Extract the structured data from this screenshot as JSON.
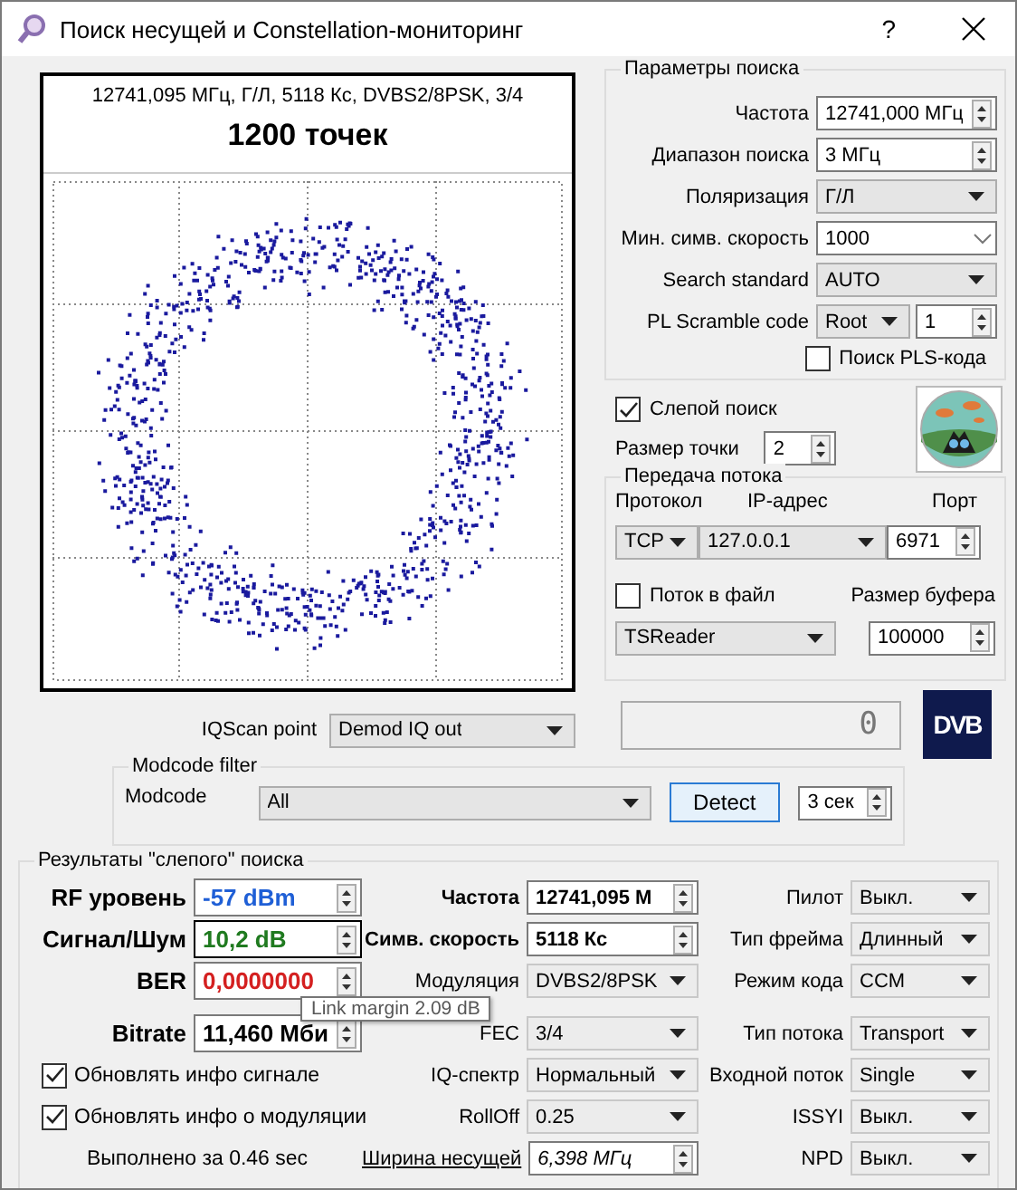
{
  "window": {
    "title": "Поиск несущей и Constellation-мониторинг",
    "help": "?"
  },
  "plot": {
    "info": "12741,095 МГц, Г/Л, 5118 Кс, DVBS2/8PSK, 3/4",
    "points": "1200 точек"
  },
  "search_params": {
    "title": "Параметры поиска",
    "fields": [
      {
        "label": "Частота",
        "value": "12741,000 МГц",
        "kind": "spin"
      },
      {
        "label": "Диапазон поиска",
        "value": "3 МГц",
        "kind": "spin"
      },
      {
        "label": "Поляризация",
        "value": "Г/Л",
        "kind": "combo"
      },
      {
        "label": "Мин. симв. скорость",
        "value": "1000",
        "kind": "edit"
      },
      {
        "label": "Search standard",
        "value": "AUTO",
        "kind": "combo"
      },
      {
        "label": "PL Scramble code",
        "value": "Root",
        "spin_value": "1",
        "kind": "combospin"
      }
    ],
    "pls_search": {
      "label": "Поиск PLS-кода",
      "checked": false
    }
  },
  "blind_search": {
    "label": "Слепой поиск",
    "checked": true
  },
  "dot_size": {
    "label": "Размер точки",
    "value": "2"
  },
  "stream": {
    "title": "Передача потока",
    "protocol_label": "Протокол",
    "ip_label": "IP-адрес",
    "port_label": "Порт",
    "protocol": "TCP",
    "ip": "127.0.0.1",
    "port": "6971",
    "to_file": {
      "label": "Поток в файл",
      "checked": false
    },
    "buffer_label": "Размер буфера",
    "target": "TSReader",
    "buffer": "100000"
  },
  "counter": "0",
  "logo": "DVB",
  "iqscan": {
    "label": "IQScan point",
    "value": "Demod IQ out"
  },
  "modcode_filter": {
    "title": "Modcode filter",
    "label": "Modcode",
    "value": "All",
    "detect": "Detect",
    "timeout": "3 сек"
  },
  "results": {
    "title": "Результаты \"слепого\" поиска",
    "signal": [
      {
        "label": "RF уровень",
        "value": "-57 dBm",
        "color": "#1f5fd6"
      },
      {
        "label": "Сигнал/Шум",
        "value": "10,2 dB",
        "color": "#1f7a1f"
      },
      {
        "label": "BER",
        "value": "0,0000000",
        "color": "#d42020"
      },
      {
        "label": "Bitrate",
        "value": "11,460 Мби",
        "color": "#000000"
      }
    ],
    "options": [
      {
        "label": "Обновлять инфо сигнале",
        "checked": true
      },
      {
        "label": "Обновлять инфо о модуляции",
        "checked": true
      }
    ],
    "elapsed": "Выполнено за 0.46 sec",
    "carrier": [
      {
        "label": "Частота",
        "value": "12741,095 М",
        "kind": "spin"
      },
      {
        "label": "Симв. скорость",
        "value": "5118 Кс",
        "kind": "spin"
      },
      {
        "label": "Модуляция",
        "value": "DVBS2/8PSK",
        "kind": "combo"
      },
      {
        "label": "FEC",
        "value": "3/4",
        "kind": "combo"
      },
      {
        "label": "IQ-спектр",
        "value": "Нормальный",
        "kind": "combo"
      },
      {
        "label": "RollOff",
        "value": "0.25",
        "kind": "combo"
      },
      {
        "label": "Ширина несущей",
        "value": "6,398 МГц",
        "kind": "link"
      }
    ],
    "stream_info": [
      {
        "label": "Пилот",
        "value": "Выкл."
      },
      {
        "label": "Тип фрейма",
        "value": "Длинный"
      },
      {
        "label": "Режим кода",
        "value": "CCM"
      },
      {
        "label": "Тип потока",
        "value": "Transport"
      },
      {
        "label": "Входной поток",
        "value": "Single"
      },
      {
        "label": "ISSYI",
        "value": "Выкл."
      },
      {
        "label": "NPD",
        "value": "Выкл."
      }
    ]
  },
  "tooltip": "Link margin 2.09 dB"
}
